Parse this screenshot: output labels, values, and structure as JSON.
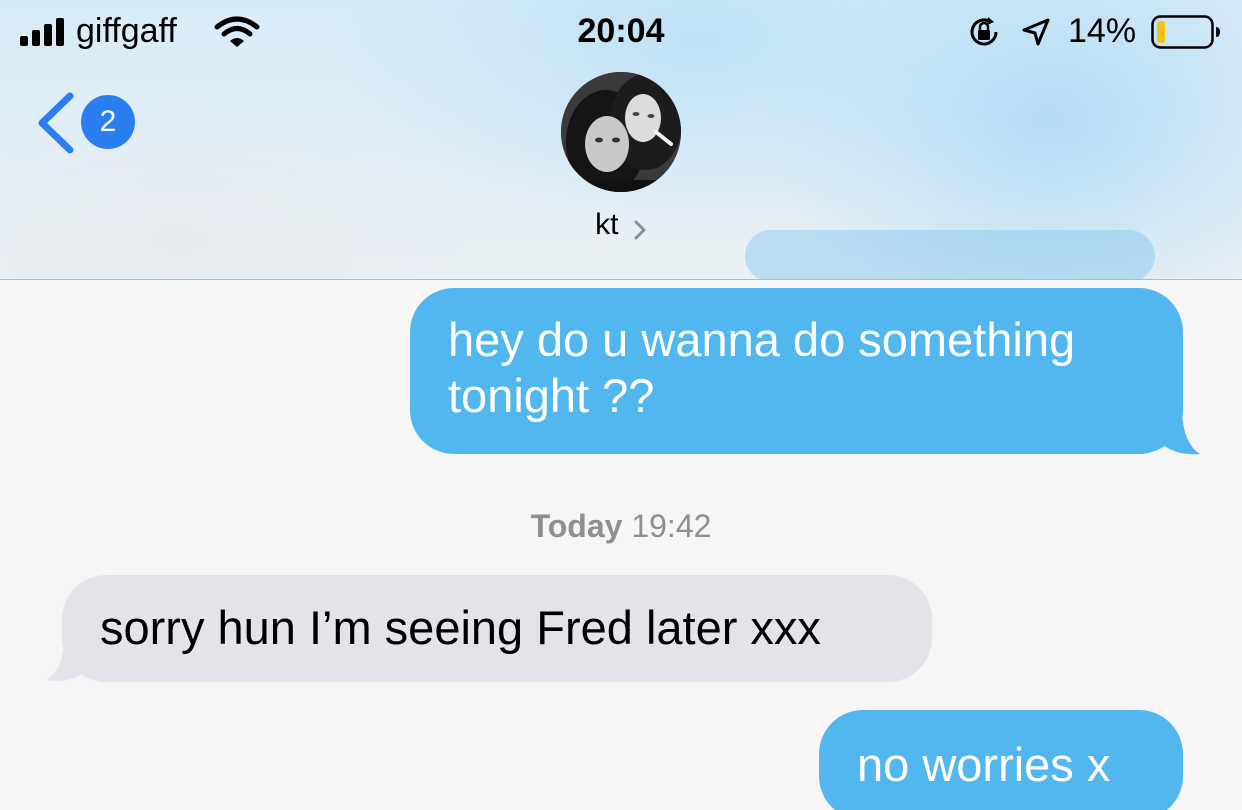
{
  "status_bar": {
    "carrier": "giffgaff",
    "time": "20:04",
    "battery_percent": "14%",
    "battery_level": 0.14,
    "signal_bars": 4
  },
  "nav": {
    "back_badge": "2",
    "contact_name": "kt"
  },
  "timestamp": {
    "day": "Today",
    "time": "19:42"
  },
  "messages": [
    {
      "direction": "sent",
      "text": "hey do u wanna do something tonight ??"
    },
    {
      "direction": "received",
      "text": "sorry hun I’m seeing Fred later xxx"
    },
    {
      "direction": "sent",
      "text": "no worries x"
    }
  ],
  "colors": {
    "sent_bubble": "#52b6ef",
    "received_bubble": "#e4e3e9",
    "accent": "#2a7ef0",
    "battery_low": "#f6c21a"
  },
  "icons": [
    "signal-icon",
    "wifi-icon",
    "rotation-lock-icon",
    "location-arrow-icon",
    "battery-icon",
    "back-chevron-icon",
    "contact-chevron-icon"
  ]
}
